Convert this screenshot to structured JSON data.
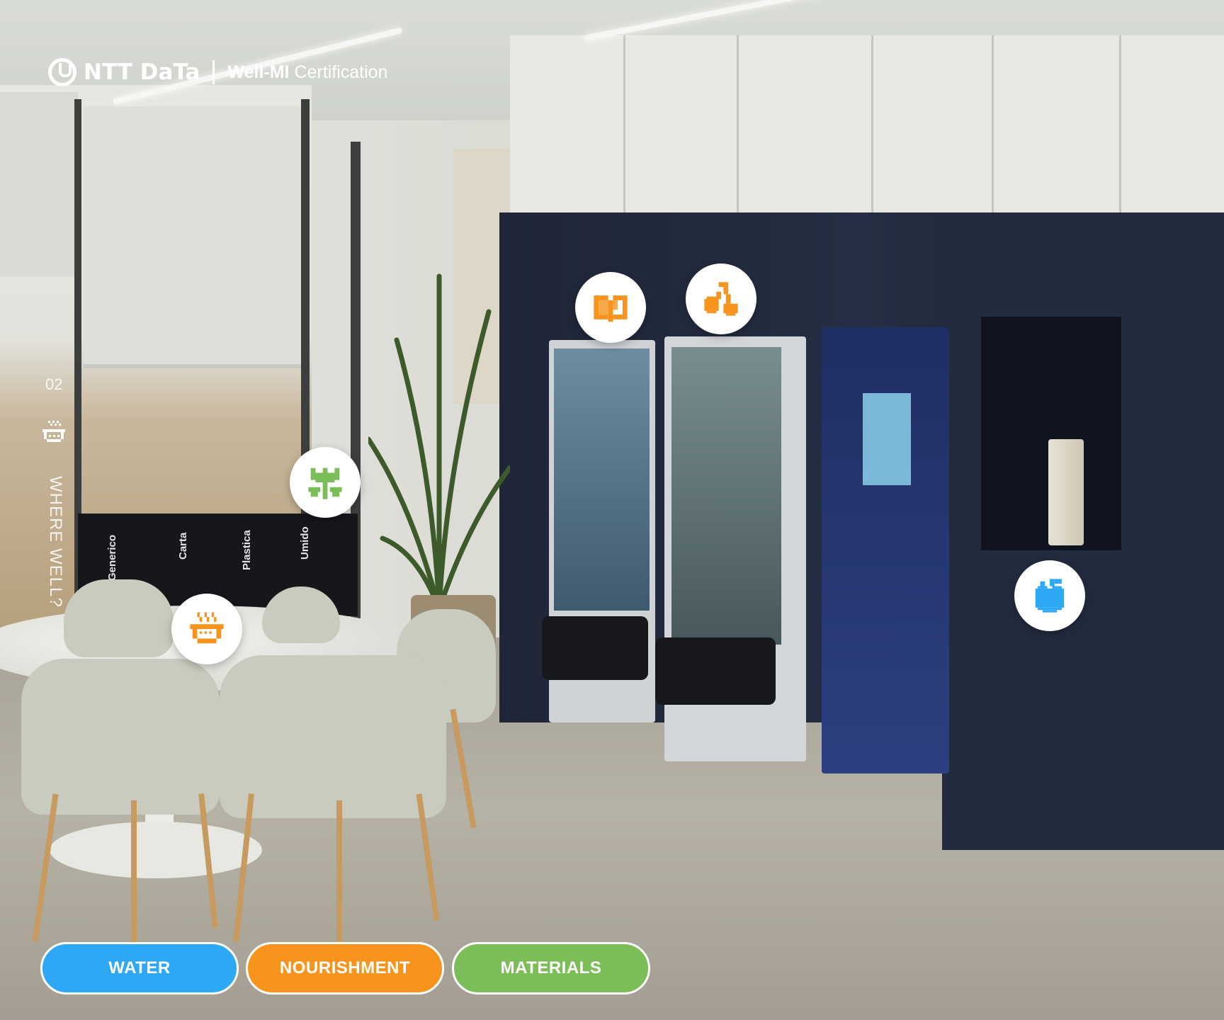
{
  "brand": {
    "company": "NTT DaTa",
    "certification_bold": "Well-MI",
    "certification_rest": "Certification"
  },
  "side_nav": {
    "number": "02",
    "label": "WHERE WELL?"
  },
  "bin_labels": [
    "Generico",
    "Carta",
    "Plastica",
    "Umido"
  ],
  "hotspots": [
    {
      "name": "nourishment-book-icon",
      "category": "nourishment"
    },
    {
      "name": "nourishment-cherries-icon",
      "category": "nourishment"
    },
    {
      "name": "materials-plant-icon",
      "category": "materials"
    },
    {
      "name": "nourishment-food-bowl-icon",
      "category": "nourishment"
    },
    {
      "name": "water-apple-icon",
      "category": "water"
    }
  ],
  "categories": [
    {
      "label": "WATER",
      "color": "#2ea7f5"
    },
    {
      "label": "NOURISHMENT",
      "color": "#f6941d"
    },
    {
      "label": "MATERIALS",
      "color": "#7bbd57"
    }
  ],
  "colors": {
    "water": "#2ea7f5",
    "nourishment": "#f6941d",
    "materials": "#7bbd57"
  }
}
